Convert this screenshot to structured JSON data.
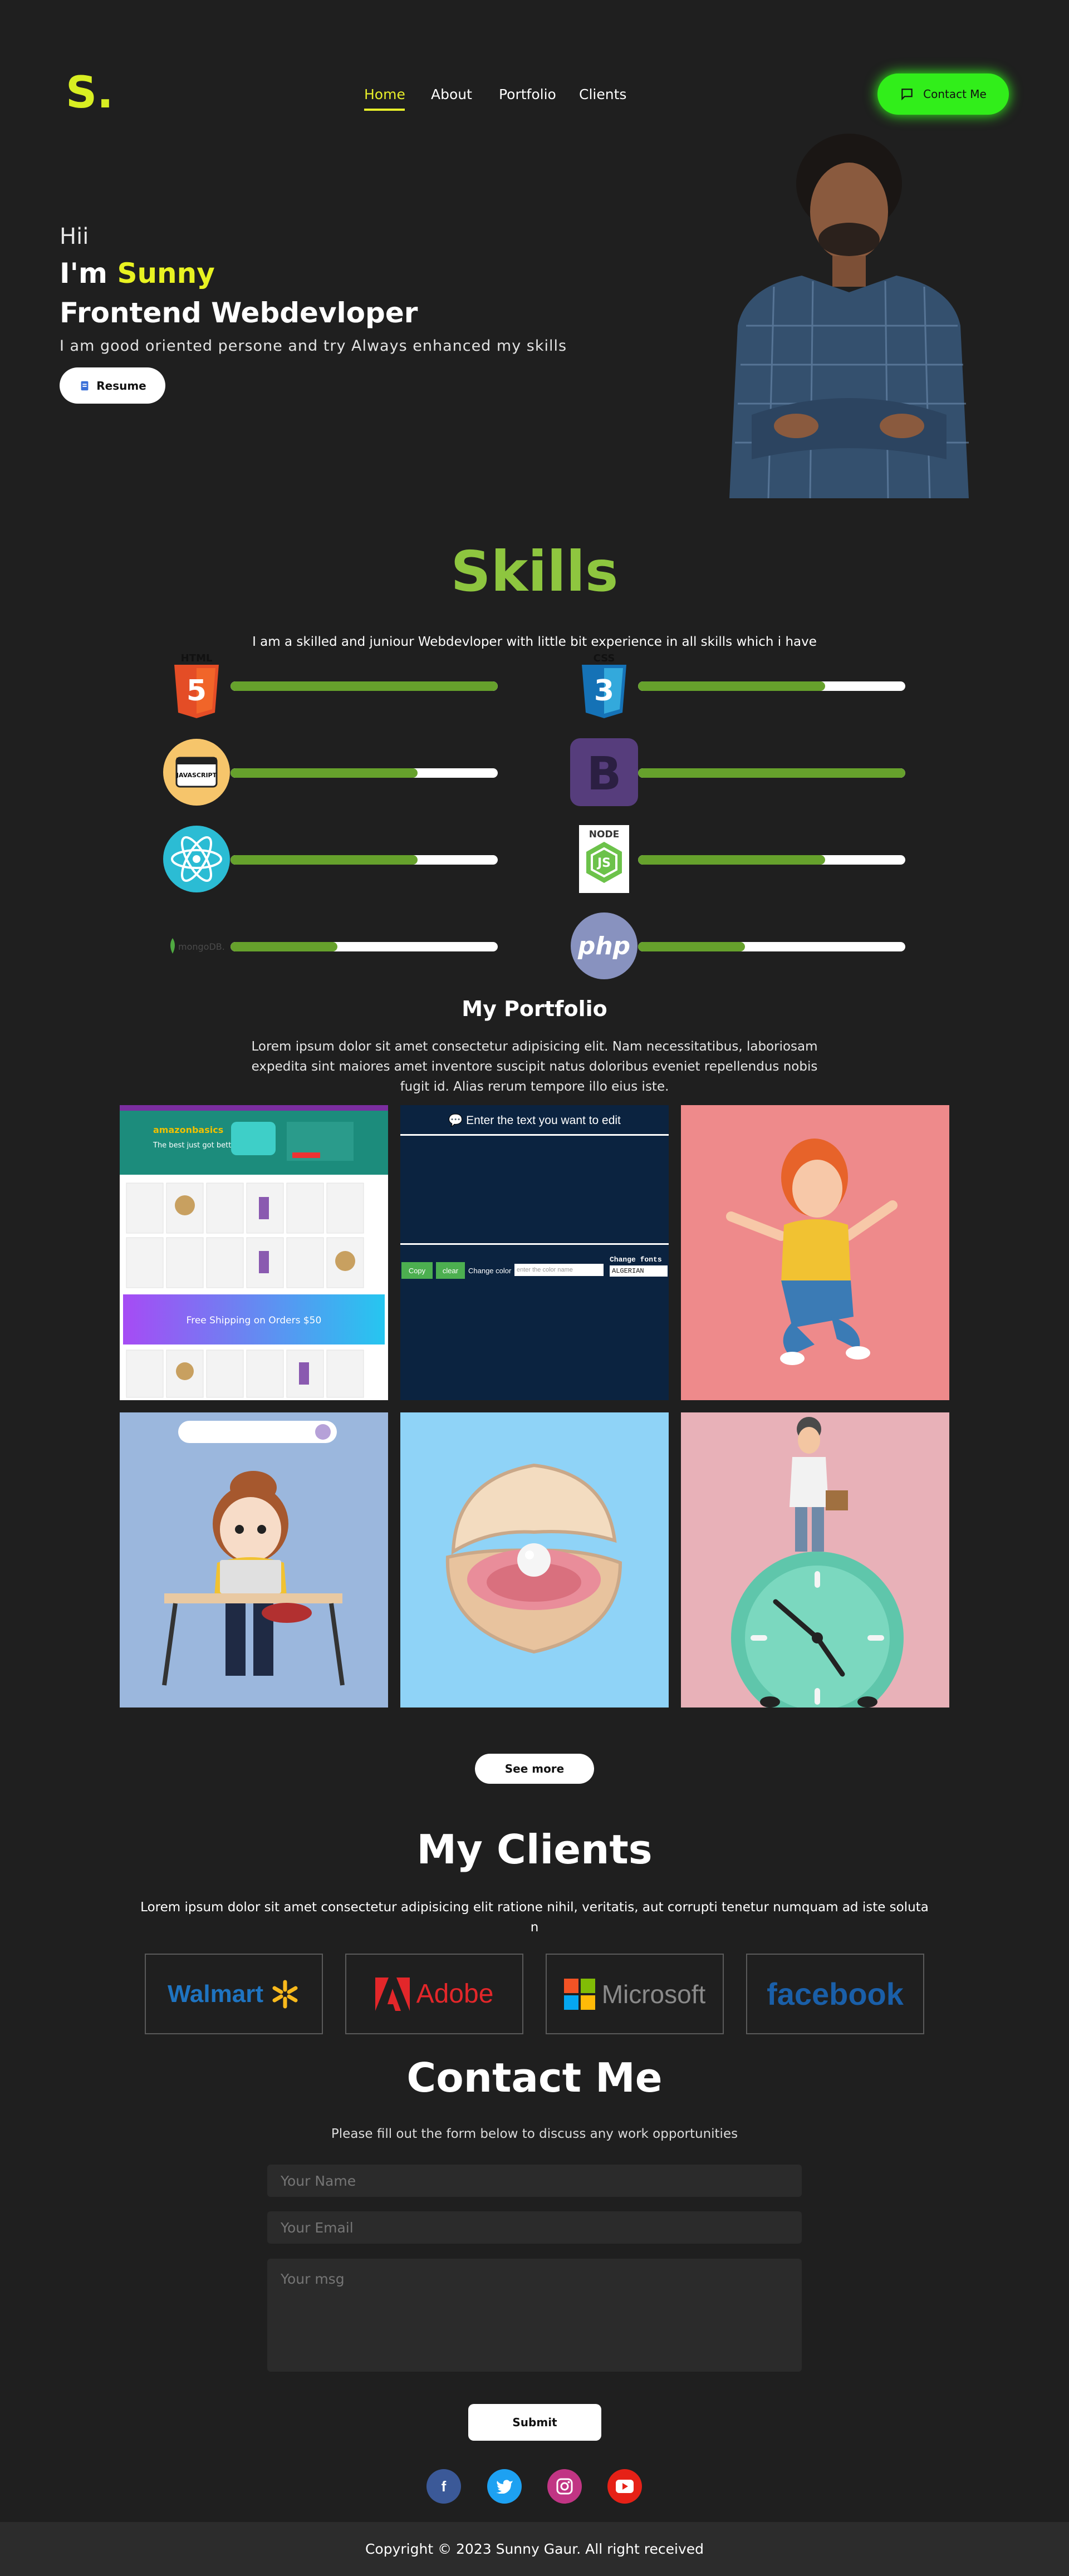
{
  "nav": {
    "logo": "S.",
    "links": [
      "Home",
      "About",
      "Portfolio",
      "Clients"
    ],
    "contact_label": "Contact Me"
  },
  "hero": {
    "greeting": "Hii",
    "im": "I'm",
    "name": "Sunny",
    "role": "Frontend Webdevloper",
    "description": "I am good oriented persone and try Always enhanced my skills",
    "resume_label": "Resume"
  },
  "skills": {
    "title": "Skills",
    "subtitle": "I am a skilled and juniour Webdevloper with little bit experience in all skills which i have",
    "items": [
      {
        "icon": "html5-icon",
        "label": "HTML",
        "level": 1.0
      },
      {
        "icon": "css3-icon",
        "label": "CSS",
        "level": 0.7
      },
      {
        "icon": "javascript-icon",
        "label": "JAVASCRIPT",
        "level": 0.7
      },
      {
        "icon": "bootstrap-icon",
        "label": "B",
        "level": 1.0
      },
      {
        "icon": "react-icon",
        "label": "",
        "level": 0.7
      },
      {
        "icon": "nodejs-icon",
        "label": "NODE",
        "level": 0.7
      },
      {
        "icon": "mongodb-icon",
        "label": "mongoDB.",
        "level": 0.4
      },
      {
        "icon": "php-icon",
        "label": "php",
        "level": 0.4
      }
    ]
  },
  "portfolio": {
    "title": "My Portfolio",
    "description": "Lorem ipsum dolor sit amet consectetur adipisicing elit. Nam necessitatibus, laboriosam expedita sint maiores amet inventore suscipit natus doloribus eveniet repellendus nobis fugit id. Alias rerum tempore illo eius iste.",
    "text_editor": {
      "heading": "Enter the text you want to edit",
      "copy": "Copy",
      "clear": "clear",
      "change_color": "Change color",
      "color_placeholder": "enter the color name",
      "change_fonts": "Change fonts",
      "font_value": "ALGERIAN"
    },
    "shop": {
      "brand": "amazonbasics",
      "headline": "The best just got better",
      "promo": "Free Shipping on Orders $50"
    },
    "see_more": "See more"
  },
  "clients": {
    "title": "My Clients",
    "description": "Lorem ipsum dolor sit amet consectetur adipisicing elit ratione nihil, veritatis, aut corrupti tenetur numquam ad iste soluta n",
    "logos": [
      "Walmart",
      "Adobe",
      "Microsoft",
      "facebook"
    ]
  },
  "contact": {
    "title": "Contact Me",
    "subtitle": "Please fill out the form below to discuss any work opportunities",
    "name_placeholder": "Your Name",
    "email_placeholder": "Your Email",
    "msg_placeholder": "Your msg",
    "submit": "Submit"
  },
  "social": [
    "facebook-icon",
    "twitter-icon",
    "instagram-icon",
    "youtube-icon"
  ],
  "footer": "Copyright © 2023 Sunny Gaur. All right received",
  "colors": {
    "background": "#1f1f1f",
    "accent_yellow": "#e7ee2a",
    "contact_green": "#31ee1a",
    "skills_green": "#8ec63f",
    "bar_fill": "#66a12c"
  }
}
